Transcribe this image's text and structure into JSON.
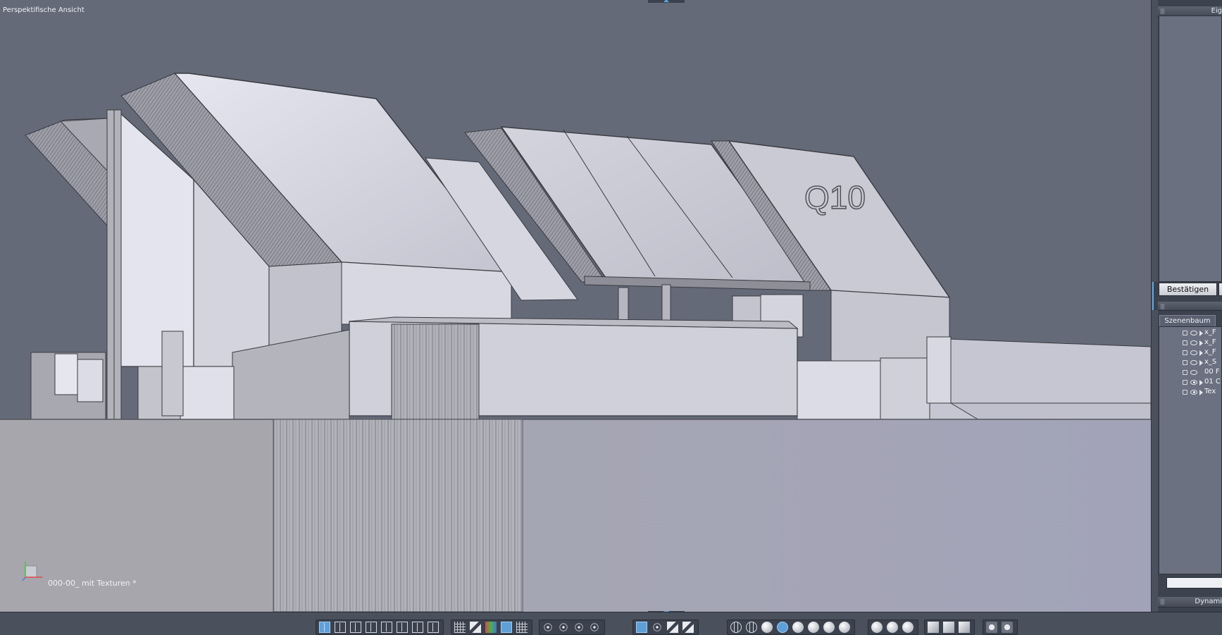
{
  "viewport": {
    "view_title": "Perspektifische Ansicht",
    "file_label": "000-00_ mit Texturen *",
    "building_label": "Q10"
  },
  "right_panel": {
    "properties_title": "Eig",
    "confirm_label": "Bestätigen",
    "scene_tab_label": "Szenenbaum",
    "tree_items": [
      {
        "label": "x_F",
        "visible": false
      },
      {
        "label": "x_F",
        "visible": false
      },
      {
        "label": "x_F",
        "visible": false
      },
      {
        "label": "x_S",
        "visible": false
      },
      {
        "label": "00 F",
        "visible": false
      },
      {
        "label": "01 C",
        "visible": true
      },
      {
        "label": "Tex",
        "visible": true
      }
    ],
    "dynamics_title": "Dynami"
  },
  "toolbar": {
    "groups": [
      {
        "name": "layout-group",
        "icons": [
          "layout-single-icon",
          "layout-2h-icon",
          "layout-3a-icon",
          "layout-3b-icon",
          "layout-3c-icon",
          "layout-3d-icon",
          "layout-2v-icon",
          "layout-4-icon"
        ]
      },
      {
        "name": "display-group",
        "icons": [
          "grid-icon",
          "paint-icon",
          "color-grid-icon",
          "texture-icon",
          "grid-fine-icon"
        ]
      },
      {
        "name": "navigation-group",
        "icons": [
          "fit-view-icon",
          "move-view-icon",
          "zoom-icon",
          "eye-icon"
        ]
      },
      {
        "name": "transform-group",
        "icons": [
          "select-arrow-icon",
          "move-tool-icon",
          "rotate-tool-icon",
          "scale-tool-icon"
        ]
      },
      {
        "name": "shading-group",
        "icons": [
          "wireframe-icon",
          "wire-sphere-icon",
          "flat-shade-icon",
          "hidden-line-icon",
          "smooth-shade-icon",
          "textured-icon",
          "gray-sphere-icon",
          "white-sphere-icon"
        ]
      },
      {
        "name": "lighting-group",
        "icons": [
          "light-sphere-icon",
          "spot-light-icon",
          "multi-light-icon"
        ]
      },
      {
        "name": "object-group",
        "icons": [
          "cube-icon",
          "eraser-icon",
          "panel-icon"
        ]
      },
      {
        "name": "render-group",
        "icons": [
          "render-icon",
          "camera-icon"
        ]
      }
    ],
    "selected": [
      "layout-single-icon",
      "texture-icon",
      "hidden-line-icon",
      "select-arrow-icon"
    ]
  }
}
